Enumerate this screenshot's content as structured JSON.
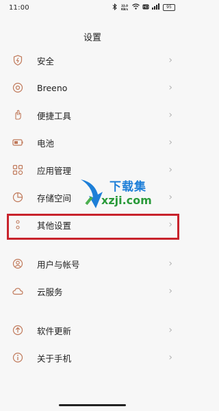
{
  "status_bar": {
    "time": "11:00",
    "network_speed": "33.0 KB/s",
    "battery_level": "95",
    "icons": [
      "bluetooth-icon",
      "network-speed-indicator",
      "wifi-icon",
      "hd-icon",
      "signal-icon",
      "battery-icon"
    ]
  },
  "page": {
    "title": "设置"
  },
  "settings": {
    "group1": [
      {
        "label": "安全",
        "icon": "shield-icon"
      },
      {
        "label": "Breeno",
        "icon": "breeno-icon"
      },
      {
        "label": "便捷工具",
        "icon": "hand-tool-icon"
      },
      {
        "label": "电池",
        "icon": "battery-icon"
      },
      {
        "label": "应用管理",
        "icon": "app-grid-icon"
      },
      {
        "label": "存储空间",
        "icon": "storage-pie-icon"
      },
      {
        "label": "其他设置",
        "icon": "more-dots-icon"
      }
    ],
    "group2": [
      {
        "label": "用户与帐号",
        "icon": "user-icon"
      },
      {
        "label": "云服务",
        "icon": "cloud-icon"
      }
    ],
    "group3": [
      {
        "label": "软件更新",
        "icon": "update-arrow-icon"
      },
      {
        "label": "关于手机",
        "icon": "info-icon"
      }
    ]
  },
  "watermark": {
    "text_cn": "下载集",
    "text_url": "xzji.com"
  },
  "colors": {
    "icon": "#c0795a",
    "highlight": "#c8232c",
    "chevron": "#b3b3b3",
    "background": "#f7f7f7"
  }
}
